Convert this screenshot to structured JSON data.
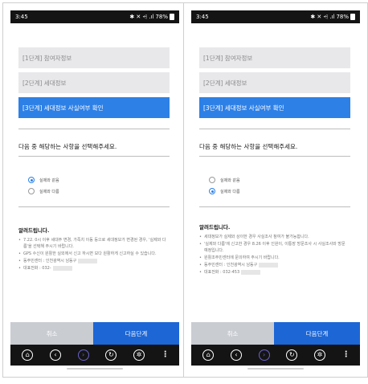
{
  "screens": [
    {
      "status_time": "3:45",
      "status_icons": "✱ ✕ ⩤ .ıl",
      "battery": "78%",
      "steps": [
        "[1단계] 참여자정보",
        "[2단계] 세대정보",
        "[3단계] 세대정보 사실여부 확인"
      ],
      "question": "다음 중 해당하는 사항을 선택해주세요.",
      "options": [
        {
          "label": "실제와 같음",
          "checked": true
        },
        {
          "label": "실제와 다름",
          "checked": false
        }
      ],
      "notice_title": "알려드립니다.",
      "notices": [
        "7.22. 0시 이후 세대주 변경, 가족치 이동 등으로 세대정보가 변경된 경우, '실제와 다름'을 선택해 주시기 바랍니다.",
        "GPS 수신이 원활한 실외에서 신고 하시면 보다 원활하게 신고하실 수 있습니다.",
        "동주민센터 : 인천광역시 남동구",
        "대표전화 : 032-"
      ],
      "cancel_label": "취소",
      "next_label": "다음단계"
    },
    {
      "status_time": "3:45",
      "status_icons": "✱ ✕ ⩤ .ıl",
      "battery": "78%",
      "steps": [
        "[1단계] 참여자정보",
        "[2단계] 세대정보",
        "[3단계] 세대정보 사실여부 확인"
      ],
      "question": "다음 중 해당하는 사항을 선택해주세요.",
      "options": [
        {
          "label": "실제와 같음",
          "checked": false
        },
        {
          "label": "실제와 다름",
          "checked": true
        }
      ],
      "notice_title": "알려드립니다.",
      "notices": [
        "세대정보가 실제와 상이한 경우 사실조사 참여가 불가능합니다.",
        "'실제와 다름'에 신고한 경우 8.26 이후 인원이, 이통장 방문조사 시 사실조사와 방문 예정입니다.",
        "원활조주민센터에 문의하여 주시기 바랍니다.",
        "동주민센터 : 인천광역시 남동구",
        "대표전화 : 032-453"
      ],
      "cancel_label": "취소",
      "next_label": "다음단계"
    }
  ],
  "nav_icons": [
    "home-icon",
    "back-icon",
    "forward-icon",
    "refresh-icon",
    "settings-icon",
    "more-icon"
  ],
  "colors": {
    "accent": "#2d80e6",
    "next_button": "#1c66d6",
    "cancel_button": "#c9ccd1",
    "step_inactive": "#e8e8ea"
  }
}
